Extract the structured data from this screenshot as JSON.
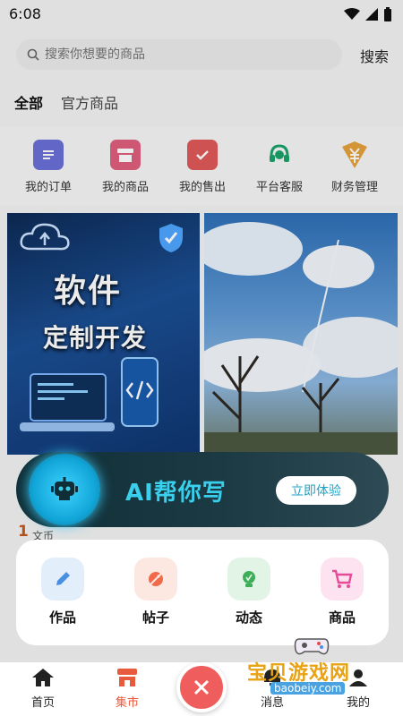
{
  "status": {
    "time": "6:08"
  },
  "search": {
    "placeholder": "搜索你想要的商品",
    "button": "搜索"
  },
  "tabs": [
    {
      "label": "全部"
    },
    {
      "label": "官方商品"
    }
  ],
  "quick_actions": [
    {
      "label": "我的订单",
      "icon": "order-list-icon",
      "color": "#6a6fd8"
    },
    {
      "label": "我的商品",
      "icon": "store-icon",
      "color": "#e0607e"
    },
    {
      "label": "我的售出",
      "icon": "checkbox-icon",
      "color": "#e05a5a"
    },
    {
      "label": "平台客服",
      "icon": "headset-icon",
      "color": "#1aa36b"
    },
    {
      "label": "财务管理",
      "icon": "yen-icon",
      "color": "#e6a23c"
    }
  ],
  "feed": {
    "card_left": {
      "title": "软件",
      "subtitle": "定制开发"
    },
    "price": "1",
    "tag": "文币"
  },
  "ai_banner": {
    "title": "AI帮你写",
    "button": "立即体验"
  },
  "create_menu": [
    {
      "label": "作品",
      "icon": "pencil-icon",
      "color": "#4a90e2",
      "bg": "#e3eefb"
    },
    {
      "label": "帖子",
      "icon": "tag-icon",
      "color": "#f06a4a",
      "bg": "#fde7e1"
    },
    {
      "label": "动态",
      "icon": "lightbulb-icon",
      "color": "#3fae5a",
      "bg": "#e2f4e5"
    },
    {
      "label": "商品",
      "icon": "cart-icon",
      "color": "#e64b9a",
      "bg": "#fce3ef"
    }
  ],
  "bottom_nav": [
    {
      "label": "首页",
      "icon": "home-icon"
    },
    {
      "label": "集市",
      "icon": "market-icon"
    },
    {
      "label": "消息",
      "icon": "message-icon"
    },
    {
      "label": "我的",
      "icon": "profile-icon"
    }
  ],
  "watermark": {
    "text": "宝贝游戏网",
    "sub": "baobeiy.com"
  },
  "colors": {
    "accent": "#e85a3c",
    "ai_cyan": "#39d0ee",
    "fab_red": "#f05d5d"
  }
}
